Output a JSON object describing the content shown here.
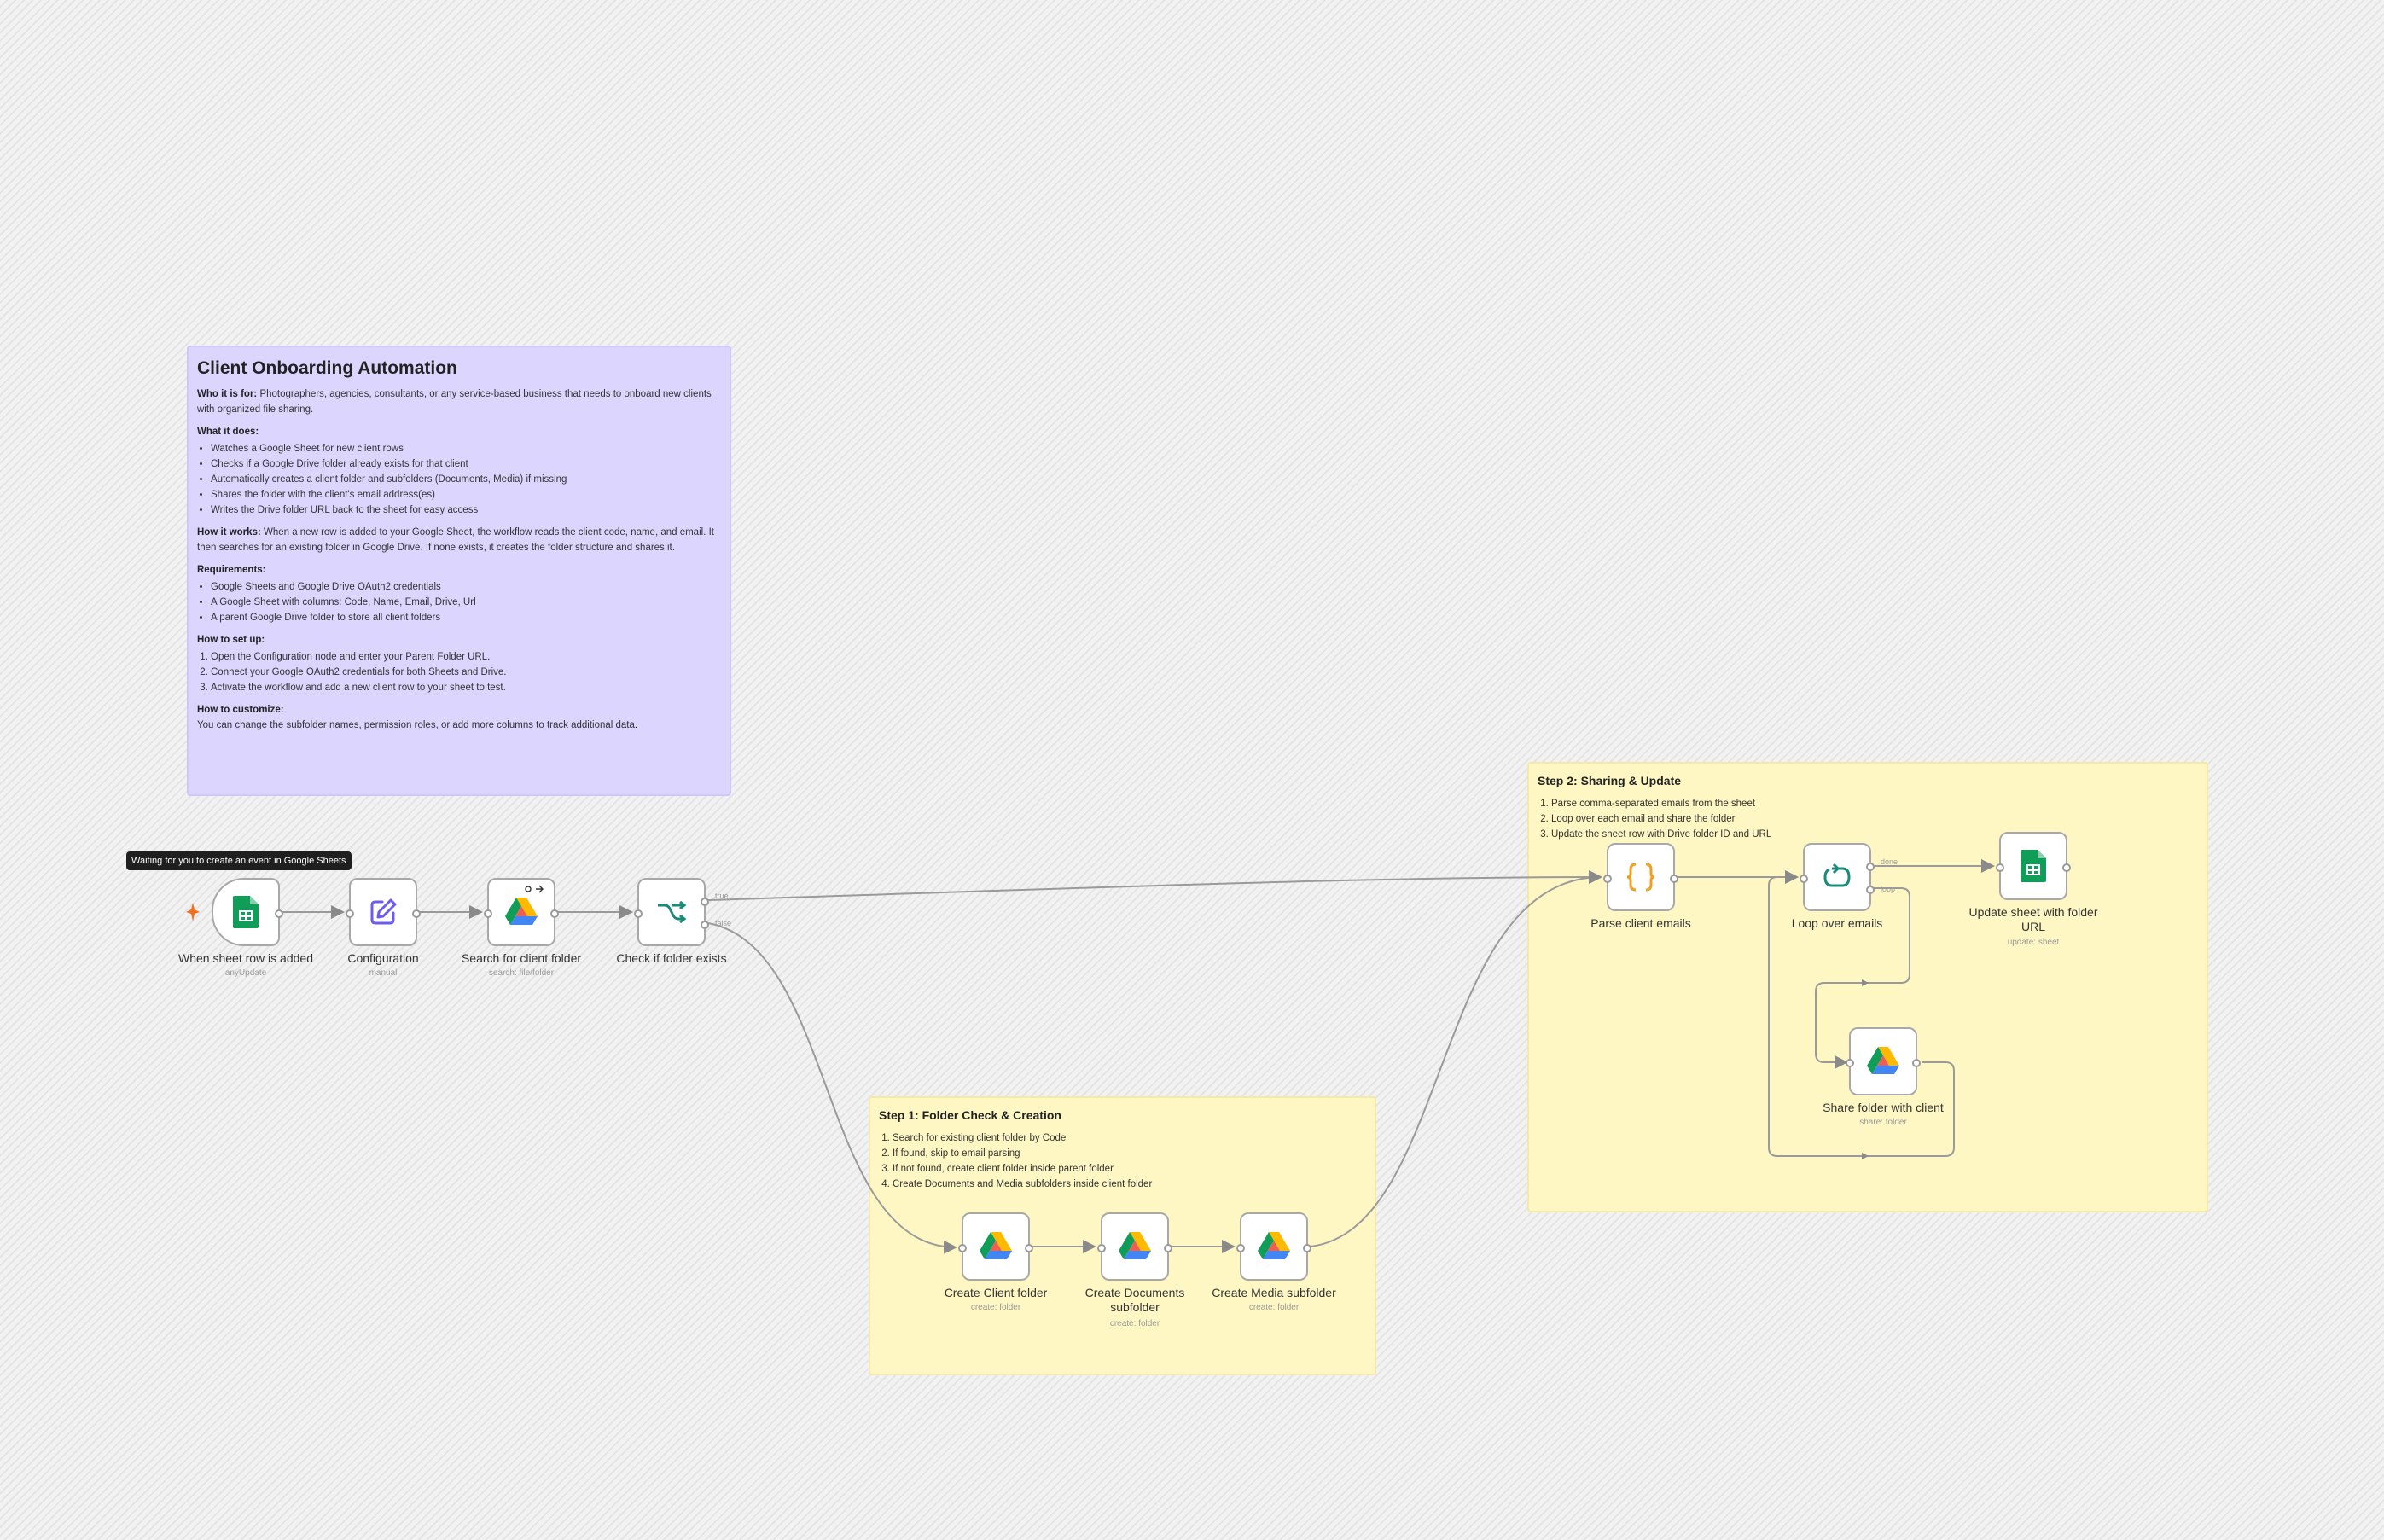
{
  "canvas": {
    "name": "Client Onboarding Automation"
  },
  "sticky_main": {
    "title": "Client Onboarding Automation",
    "who_label": "Who it is for:",
    "who_text": " Photographers, agencies, consultants, or any service-based business that needs to onboard new clients with organized file sharing.",
    "what_label": "What it does:",
    "what_items": [
      "Watches a Google Sheet for new client rows",
      "Checks if a Google Drive folder already exists for that client",
      "Automatically creates a client folder and subfolders (Documents, Media) if missing",
      "Shares the folder with the client's email address(es)",
      "Writes the Drive folder URL back to the sheet for easy access"
    ],
    "how_label": "How it works:",
    "how_text": " When a new row is added to your Google Sheet, the workflow reads the client code, name, and email. It then searches for an existing folder in Google Drive. If none exists, it creates the folder structure and shares it.",
    "req_label": "Requirements:",
    "req_items": [
      "Google Sheets and Google Drive OAuth2 credentials",
      "A Google Sheet with columns: Code, Name, Email, Drive, Url",
      "A parent Google Drive folder to store all client folders"
    ],
    "setup_label": "How to set up:",
    "setup_items": [
      "Open the Configuration node and enter your Parent Folder URL.",
      "Connect your Google OAuth2 credentials for both Sheets and Drive.",
      "Activate the workflow and add a new client row to your sheet to test."
    ],
    "customize_label": "How to customize:",
    "customize_text": "You can change the subfolder names, permission roles, or add more columns to track additional data."
  },
  "sticky_step1": {
    "title": "Step 1: Folder Check & Creation",
    "items": [
      "Search for existing client folder by Code",
      "If found, skip to email parsing",
      "If not found, create client folder inside parent folder",
      "Create Documents and Media subfolders inside client folder"
    ]
  },
  "sticky_step2": {
    "title": "Step 2: Sharing & Update",
    "items": [
      "Parse comma-separated emails from the sheet",
      "Loop over each email and share the folder",
      "Update the sheet row with Drive folder ID and URL"
    ]
  },
  "tooltip": "Waiting for you to create an event in Google Sheets",
  "nodes": {
    "trigger": {
      "label": "When sheet row is added",
      "sub": "anyUpdate",
      "icon": "google-sheets-icon"
    },
    "config": {
      "label": "Configuration",
      "sub": "manual",
      "icon": "pencil-edit-icon"
    },
    "search": {
      "label": "Search for client folder",
      "sub": "search: file/folder",
      "icon": "google-drive-icon"
    },
    "check": {
      "label": "Check if folder exists",
      "sub": "",
      "icon": "if-branch-icon"
    },
    "create_client": {
      "label": "Create Client folder",
      "sub": "create: folder",
      "icon": "google-drive-icon"
    },
    "create_docs": {
      "label": "Create Documents subfolder",
      "sub": "create: folder",
      "icon": "google-drive-icon"
    },
    "create_media": {
      "label": "Create Media subfolder",
      "sub": "create: folder",
      "icon": "google-drive-icon"
    },
    "parse": {
      "label": "Parse client emails",
      "sub": "",
      "icon": "code-braces-icon"
    },
    "loop": {
      "label": "Loop over emails",
      "sub": "",
      "icon": "loop-icon"
    },
    "update": {
      "label": "Update sheet with folder URL",
      "sub": "update: sheet",
      "icon": "google-sheets-icon"
    },
    "share": {
      "label": "Share folder with client",
      "sub": "share: folder",
      "icon": "google-drive-icon"
    }
  },
  "branches": {
    "true": "true",
    "false": "false",
    "done": "done",
    "loop": "loop"
  },
  "colors": {
    "sticky_purple": "#dcd6ff",
    "sticky_yellow": "#fff7c3",
    "sheets_green": "#0f9d58",
    "edit_purple": "#6b5cf0",
    "if_teal": "#1a8a7a",
    "code_orange": "#f0a020",
    "trigger_spark": "#f07020"
  }
}
